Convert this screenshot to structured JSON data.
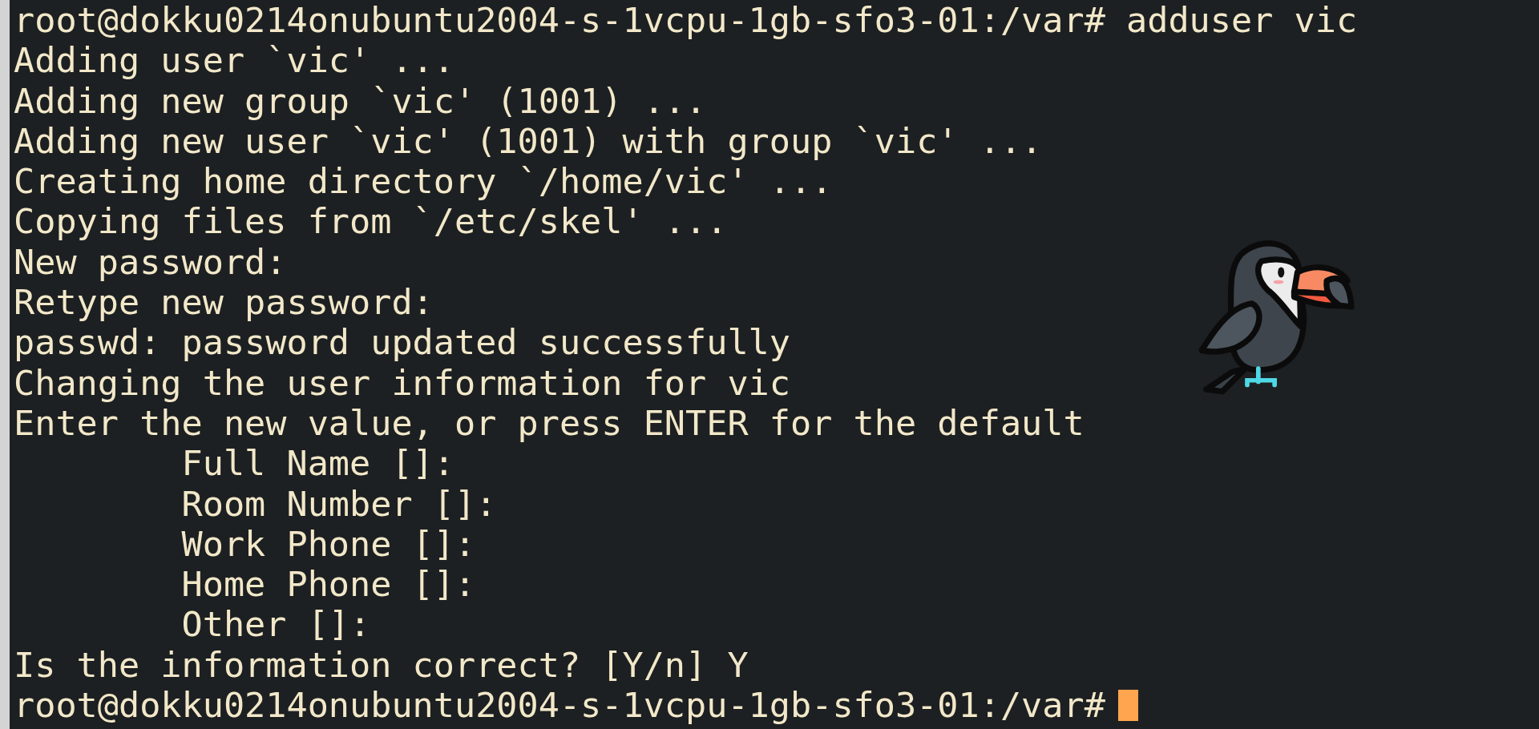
{
  "terminal": {
    "lines": [
      {
        "kind": "prompt",
        "prompt": "root@dokku0214onubuntu2004-s-1vcpu-1gb-sfo3-01:/var#",
        "command": "adduser vic"
      },
      {
        "kind": "output",
        "text": "Adding user `vic' ..."
      },
      {
        "kind": "output",
        "text": "Adding new group `vic' (1001) ..."
      },
      {
        "kind": "output",
        "text": "Adding new user `vic' (1001) with group `vic' ..."
      },
      {
        "kind": "output",
        "text": "Creating home directory `/home/vic' ..."
      },
      {
        "kind": "output",
        "text": "Copying files from `/etc/skel' ..."
      },
      {
        "kind": "output",
        "text": "New password:"
      },
      {
        "kind": "output",
        "text": "Retype new password:"
      },
      {
        "kind": "output",
        "text": "passwd: password updated successfully"
      },
      {
        "kind": "output",
        "text": "Changing the user information for vic"
      },
      {
        "kind": "output",
        "text": "Enter the new value, or press ENTER for the default"
      },
      {
        "kind": "field",
        "text": "Full Name []:"
      },
      {
        "kind": "field",
        "text": "Room Number []:"
      },
      {
        "kind": "field",
        "text": "Work Phone []:"
      },
      {
        "kind": "field",
        "text": "Home Phone []:"
      },
      {
        "kind": "field",
        "text": "Other []:"
      },
      {
        "kind": "output",
        "text": "Is the information correct? [Y/n] Y"
      },
      {
        "kind": "prompt",
        "prompt": "root@dokku0214onubuntu2004-s-1vcpu-1gb-sfo3-01:/var#"
      }
    ],
    "cursor_visible": true
  }
}
